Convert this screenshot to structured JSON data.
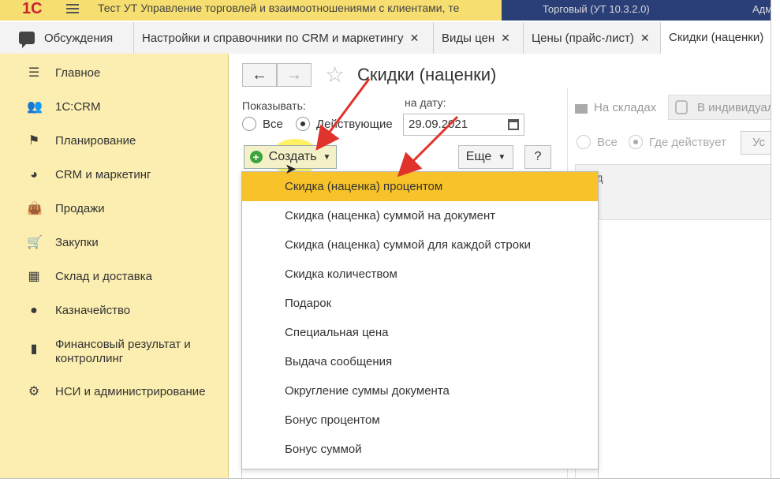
{
  "titlebar": {
    "logo": "1С",
    "title": "Тест УТ Управление торговлей и взаимоотношениями с клиентами, те",
    "user": "Торговый (УТ 10.3.2.0)",
    "user_extra": "Адм"
  },
  "tabs": [
    {
      "label": "Обсуждения"
    },
    {
      "label": "Настройки и справочники по CRM и маркетингу"
    },
    {
      "label": "Виды цен"
    },
    {
      "label": "Цены (прайс-лист)"
    },
    {
      "label": "Скидки (наценки)"
    }
  ],
  "close_glyph": "✕",
  "sidebar": {
    "items": [
      {
        "label": "Главное",
        "icon": "menu-icon"
      },
      {
        "label": "1С:CRM",
        "icon": "people-icon"
      },
      {
        "label": "Планирование",
        "icon": "planning-icon"
      },
      {
        "label": "CRM и маркетинг",
        "icon": "pie-chart-icon"
      },
      {
        "label": "Продажи",
        "icon": "bag-icon"
      },
      {
        "label": "Закупки",
        "icon": "cart-icon"
      },
      {
        "label": "Склад и доставка",
        "icon": "warehouse-icon"
      },
      {
        "label": "Казначейство",
        "icon": "coin-icon"
      },
      {
        "label": "Финансовый результат и контроллинг",
        "icon": "bar-chart-icon"
      },
      {
        "label": "НСИ и администрирование",
        "icon": "gear-icon"
      }
    ]
  },
  "main": {
    "back": "←",
    "forward": "→",
    "title": "Скидки (наценки)",
    "show_label": "Показывать:",
    "radio_all": "Все",
    "radio_active": "Действующие",
    "date_label": "на дату:",
    "date_value": "29.09.2021",
    "create_button": "Создать",
    "more_button": "Еще",
    "help_button": "?"
  },
  "dropdown": {
    "items": [
      "Скидка (наценка) процентом",
      "Скидка (наценка) суммой на документ",
      "Скидка (наценка) суммой для каждой строки",
      "Скидка количеством",
      "Подарок",
      "Специальная цена",
      "Выдача сообщения",
      "Округление суммы документа",
      "Бонус процентом",
      "Бонус суммой"
    ],
    "selected_index": 0
  },
  "right_pane": {
    "tab_warehouses": "На складах",
    "tab_individual": "В индивидуал",
    "radio_all": "Все",
    "radio_where": "Где действует",
    "button_partial": "Ус",
    "column_header": "клад"
  },
  "colors": {
    "accent_yellow": "#f8c32a",
    "sidebar_bg": "#fbeeb0",
    "annotation_red": "#e0332b"
  }
}
